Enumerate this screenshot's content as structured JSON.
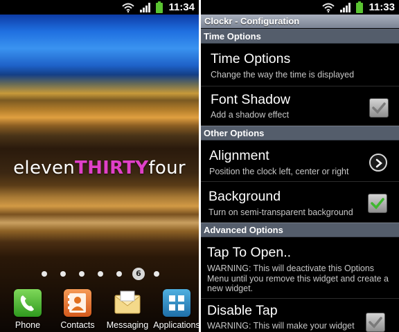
{
  "home": {
    "status_time": "11:34",
    "clock": {
      "part1": "eleven",
      "part2": "THIRTY",
      "part3": "four"
    },
    "current_page": "6",
    "dock": [
      {
        "label": "Phone",
        "icon": "phone-icon"
      },
      {
        "label": "Contacts",
        "icon": "contacts-icon"
      },
      {
        "label": "Messaging",
        "icon": "messaging-icon"
      },
      {
        "label": "Applications",
        "icon": "applications-icon"
      }
    ]
  },
  "config": {
    "status_time": "11:33",
    "title": "Clockr - Configuration",
    "sections": {
      "time": "Time Options",
      "other": "Other Options",
      "advanced": "Advanced Options"
    },
    "prefs": {
      "time_options": {
        "title": "Time Options",
        "summary": "Change the way the time is displayed"
      },
      "font_shadow": {
        "title": "Font Shadow",
        "summary": "Add a shadow effect",
        "checked": false
      },
      "alignment": {
        "title": "Alignment",
        "summary": "Position the clock left, center or right"
      },
      "background": {
        "title": "Background",
        "summary": "Turn on semi-transparent background",
        "checked": true
      },
      "tap_to_open": {
        "title": "Tap To Open..",
        "summary": "WARNING: This will deactivate this Options Menu until you remove this widget and create a new widget."
      },
      "disable_tap": {
        "title": "Disable Tap",
        "summary": "WARNING: This will make your widget",
        "checked": false
      }
    }
  },
  "colors": {
    "clock_highlight": "#e040c8",
    "checkbox_checked": "#3fb82f",
    "section_header": "#545d6b",
    "battery": "#5ac431"
  }
}
